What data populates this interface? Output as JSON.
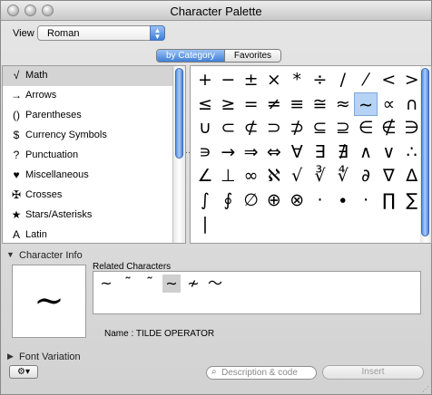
{
  "window": {
    "title": "Character Palette"
  },
  "view": {
    "label": "View :",
    "selected": "Roman"
  },
  "tabs": [
    {
      "label": "by Category",
      "active": true
    },
    {
      "label": "Favorites",
      "active": false
    }
  ],
  "categories": [
    {
      "icon": "√",
      "label": "Math",
      "selected": true
    },
    {
      "icon": "→",
      "label": "Arrows"
    },
    {
      "icon": "()",
      "label": "Parentheses"
    },
    {
      "icon": "$",
      "label": "Currency Symbols"
    },
    {
      "icon": "?",
      "label": "Punctuation"
    },
    {
      "icon": "♥",
      "label": "Miscellaneous"
    },
    {
      "icon": "✠",
      "label": "Crosses"
    },
    {
      "icon": "★",
      "label": "Stars/Asterisks"
    },
    {
      "icon": "A",
      "label": "Latin"
    }
  ],
  "glyphs": [
    [
      "+",
      "−",
      "±",
      "×",
      "*",
      "÷",
      "/",
      "⁄",
      "<",
      ">"
    ],
    [
      "≤",
      "≥",
      "=",
      "≠",
      "≡",
      "≅",
      "≈",
      "∼",
      "∝",
      "∩"
    ],
    [
      "∪",
      "⊂",
      "⊄",
      "⊃",
      "⊅",
      "⊆",
      "⊇",
      "∈",
      "∉",
      "∋"
    ],
    [
      "∍",
      "→",
      "⇒",
      "⇔",
      "∀",
      "∃",
      "∄",
      "∧",
      "∨",
      "∴"
    ],
    [
      "∠",
      "⊥",
      "∞",
      "ℵ",
      "√",
      "∛",
      "∜",
      "∂",
      "∇",
      "∆"
    ],
    [
      "∫",
      "∮",
      "∅",
      "⊕",
      "⊗",
      "·",
      "∙",
      "⋅",
      "∏",
      "∑"
    ],
    [
      "|",
      "",
      "",
      "",
      "",
      "",
      "",
      "",
      "",
      ""
    ]
  ],
  "selected_glyph": {
    "row": 1,
    "col": 7
  },
  "character_info": {
    "section_label": "Character Info",
    "preview": "∼",
    "related_label": "Related Characters",
    "related": [
      "~",
      "˜",
      "˜",
      "∼",
      "≁",
      "〜"
    ],
    "related_selected": 3,
    "name_label": "Name :",
    "name_value": "TILDE OPERATOR"
  },
  "font_variation": {
    "section_label": "Font Variation"
  },
  "footer": {
    "gear_label": "⚙▾",
    "search_placeholder": "Description & code",
    "insert_label": "Insert"
  }
}
